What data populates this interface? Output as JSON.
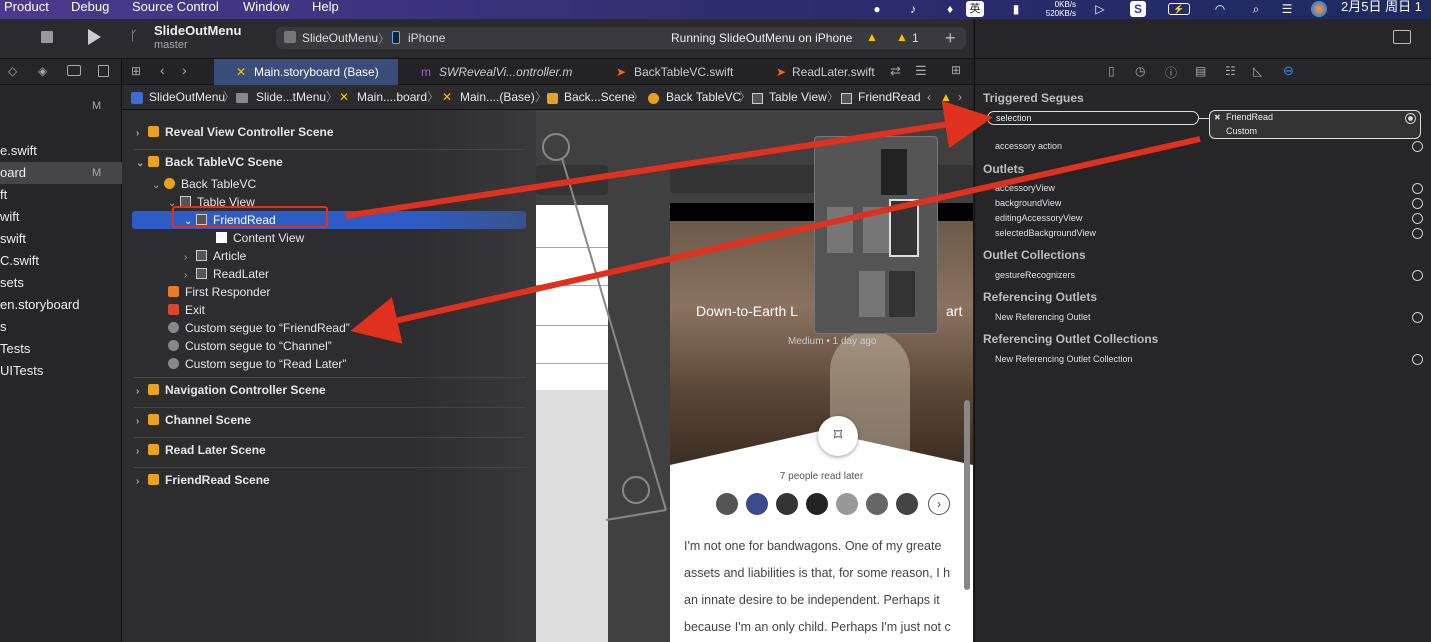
{
  "menubar": {
    "items": [
      "Product",
      "Debug",
      "Source Control",
      "Window",
      "Help"
    ],
    "net_up": "0KB/s",
    "net_down": "520KB/s",
    "ime": "英",
    "clock": "2月5日 周日 1"
  },
  "toolbar": {
    "scheme_title": "SlideOutMenu",
    "branch": "master",
    "target_app": "SlideOutMenu",
    "device": "iPhone",
    "status": "Running SlideOutMenu on iPhone",
    "warnings": "1"
  },
  "tabs": [
    {
      "label": "Main.storyboard (Base)"
    },
    {
      "label": "SWRevealVi...ontroller.m"
    },
    {
      "label": "BackTableVC.swift"
    },
    {
      "label": "ReadLater.swift"
    }
  ],
  "jumpbar": [
    "SlideOutMenu",
    "Slide...tMenu",
    "Main....board",
    "Main....(Base)",
    "Back...Scene",
    "Back TableVC",
    "Table View",
    "FriendRead"
  ],
  "navigator": {
    "badge_m": "M",
    "items": [
      {
        "label": "e.swift",
        "badge": ""
      },
      {
        "label": "oard",
        "badge": "M"
      },
      {
        "label": "ft",
        "badge": ""
      },
      {
        "label": "wift",
        "badge": ""
      },
      {
        "label": "swift",
        "badge": ""
      },
      {
        "label": "C.swift",
        "badge": ""
      },
      {
        "label": "sets",
        "badge": ""
      },
      {
        "label": "en.storyboard",
        "badge": ""
      },
      {
        "label": "s",
        "badge": ""
      },
      {
        "label": "Tests",
        "badge": ""
      },
      {
        "label": "UITests",
        "badge": ""
      }
    ]
  },
  "outline": {
    "scene_reveal": "Reveal View Controller Scene",
    "scene_back": "Back TableVC Scene",
    "back_tablevc": "Back TableVC",
    "table_view": "Table View",
    "friendread": "FriendRead",
    "content_view": "Content View",
    "article": "Article",
    "readlater": "ReadLater",
    "first_responder": "First Responder",
    "exit": "Exit",
    "segue1": "Custom segue to “FriendRead”",
    "segue2": "Custom segue to “Channel”",
    "segue3": "Custom segue to “Read Later”",
    "scene_nav": "Navigation Controller Scene",
    "scene_channel": "Channel Scene",
    "scene_readlater": "Read Later Scene",
    "scene_friendread": "FriendRead Scene"
  },
  "canvas": {
    "article_title": "Down-to-Earth L",
    "article_title_right": "art",
    "article_meta": "Medium • 1 day ago",
    "people_read": "7 people read later",
    "body_lines": [
      "I'm not one for bandwagons. One of my greate",
      "assets and liabilities is that, for some reason, I h",
      "an innate desire to be independent. Perhaps it",
      "because I'm an only child. Perhaps I'm just not c"
    ]
  },
  "inspector": {
    "triggered_segues": "Triggered Segues",
    "selection": "selection",
    "conn_target": "FriendRead",
    "conn_type": "Custom",
    "accessory_action": "accessory action",
    "outlets": "Outlets",
    "outlet_items": [
      "accessoryView",
      "backgroundView",
      "editingAccessoryView",
      "selectedBackgroundView"
    ],
    "outlet_collections": "Outlet Collections",
    "gesture": "gestureRecognizers",
    "referencing_outlets": "Referencing Outlets",
    "new_ref_outlet": "New Referencing Outlet",
    "referencing_collections": "Referencing Outlet Collections",
    "new_ref_collection": "New Referencing Outlet Collection"
  },
  "colors": {
    "selection": "#2e5cc7",
    "annotation_arrow": "#e0301e",
    "active_tab": "#3a4d7a"
  }
}
